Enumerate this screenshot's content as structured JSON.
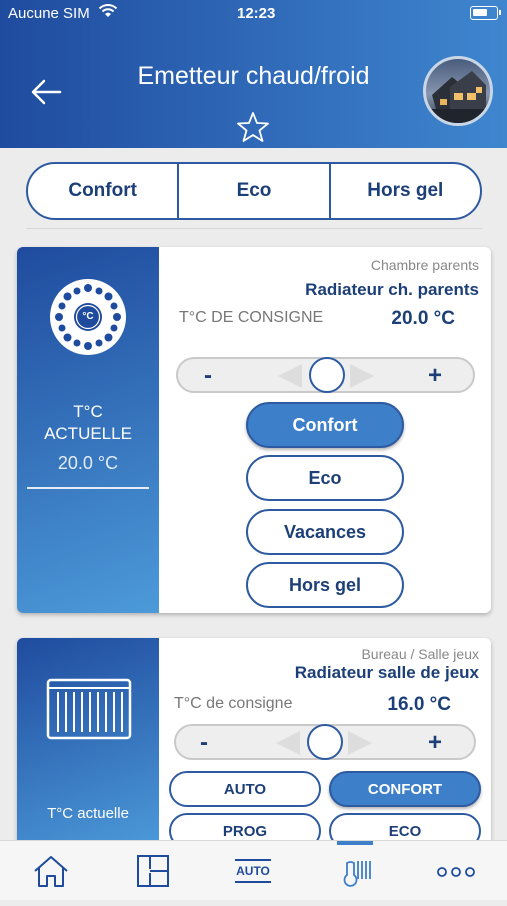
{
  "status_bar": {
    "carrier": "Aucune SIM",
    "time": "12:23"
  },
  "header": {
    "title": "Emetteur chaud/froid"
  },
  "mode_bar": {
    "items": [
      "Confort",
      "Eco",
      "Hors gel"
    ]
  },
  "card1": {
    "room": "Chambre parents",
    "device": "Radiateur ch. parents",
    "consigne_label": "T°C DE CONSIGNE",
    "consigne_value": "20.0 °C",
    "current_label": "T°C ACTUELLE",
    "current_value": "20.0 °C",
    "thumb_icon_label": "°C",
    "slider": {
      "minus": "-",
      "plus": "+"
    },
    "modes": [
      "Confort",
      "Eco",
      "Vacances",
      "Hors gel"
    ],
    "active_mode": "Confort"
  },
  "card2": {
    "room": "Bureau / Salle jeux",
    "device": "Radiateur salle de jeux",
    "consigne_label": "T°C de consigne",
    "consigne_value": "16.0 °C",
    "current_label": "T°C actuelle",
    "slider": {
      "minus": "-",
      "plus": "+"
    },
    "modes": [
      "AUTO",
      "CONFORT",
      "PROG",
      "ECO"
    ],
    "active_mode": "CONFORT"
  },
  "bottom_nav": {
    "items": [
      "home-icon",
      "floorplan-icon",
      "auto-icon",
      "heating-icon",
      "more-icon"
    ],
    "auto_label": "AUTO",
    "more_label": "ooo"
  },
  "colors": {
    "primary_dark": "#1f4b9e",
    "primary_light": "#4c9ad9",
    "text_dark_blue": "#1d3f78",
    "active_pill": "#3d7fc9"
  }
}
